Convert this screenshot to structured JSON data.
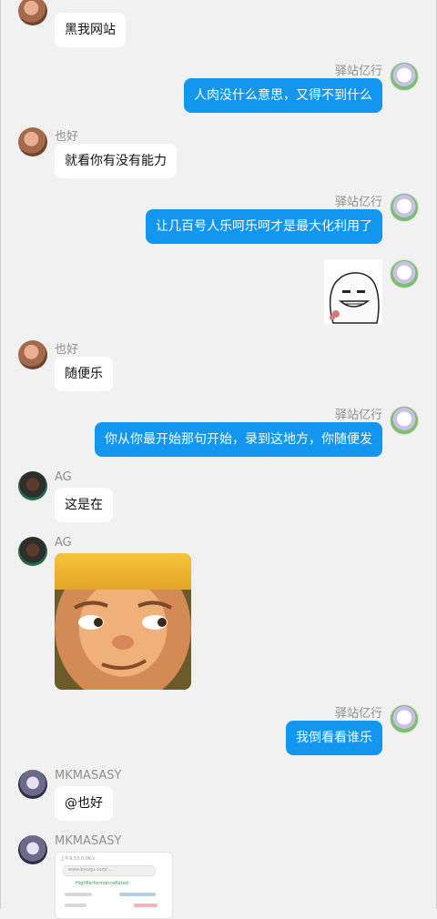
{
  "users": {
    "yihao": "也好",
    "yizhan": "驿站亿行",
    "ag": "AG",
    "mk": "MKMASASY"
  },
  "messages": [
    {
      "text": "黑我网站"
    },
    {
      "text": "人肉没什么意思，又得不到什么"
    },
    {
      "text": "就看你有没有能力"
    },
    {
      "text": "让几百号人乐呵乐呵才是最大化利用了"
    },
    {
      "sticker": "grinning-ghost-sticker"
    },
    {
      "text": "随便乐"
    },
    {
      "text": "你从你最开始那句开始，录到这地方，你随便发"
    },
    {
      "text": "这是在"
    },
    {
      "sticker": "smirking-boy-face-sticker"
    },
    {
      "text": "我倒看看谁乐"
    },
    {
      "text": "@也好"
    },
    {
      "screenshot": {
        "status_time": "上午9:53 0.0K/s",
        "url": "www.bvuqu.com/...",
        "title": "HighPerformanceRated"
      }
    }
  ]
}
